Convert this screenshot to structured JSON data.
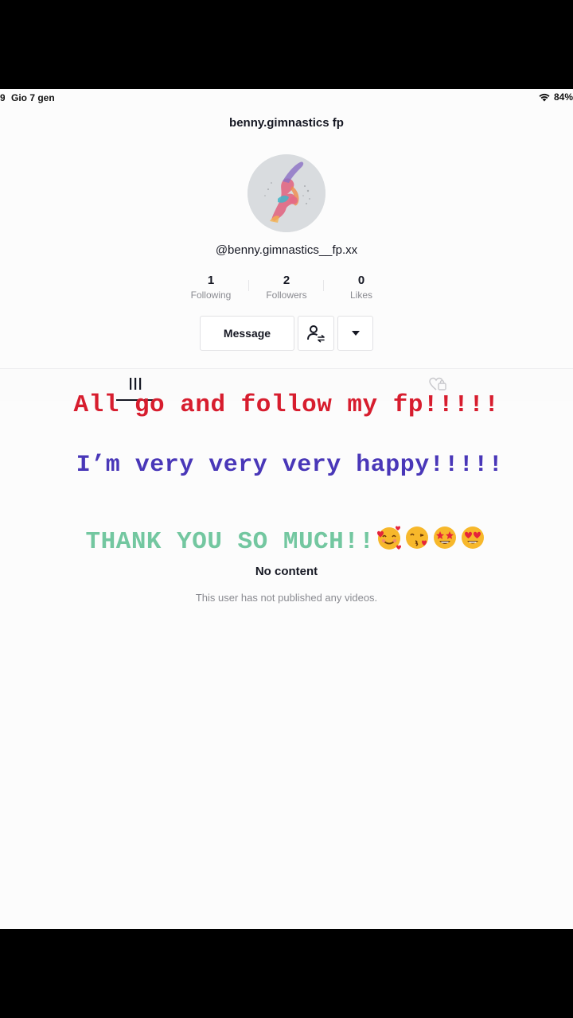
{
  "status_bar": {
    "time_fragment": "9",
    "date": "Gio 7 gen",
    "battery": "84%"
  },
  "profile": {
    "title": "benny.gimnastics fp",
    "username": "@benny.gimnastics__fp.xx",
    "stats": [
      {
        "value": "1",
        "label": "Following"
      },
      {
        "value": "2",
        "label": "Followers"
      },
      {
        "value": "0",
        "label": "Likes"
      }
    ],
    "message_label": "Message"
  },
  "captions": {
    "line1": "All go and follow my fp!!!!!",
    "line2": "I’m very very very happy!!!!!",
    "line3": "THANK YOU SO MUCH!!"
  },
  "empty_state": {
    "title": "No content",
    "subtitle": "This user has not published any videos."
  },
  "icons": [
    "wifi-icon",
    "more-icon",
    "add-friend-icon",
    "dropdown-icon",
    "grid-icon",
    "liked-icon",
    "emoji-icons"
  ],
  "colors": {
    "caption_red": "#d71d2e",
    "caption_purple": "#4937b8",
    "caption_green": "#73c7a0",
    "text_primary": "#161823",
    "text_secondary": "#8a8b91"
  }
}
